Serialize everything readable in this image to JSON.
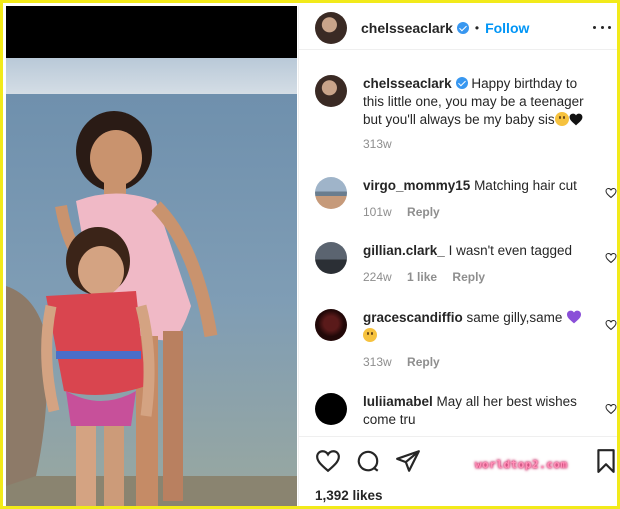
{
  "post": {
    "username": "chelsseaclark",
    "follow_label": "Follow",
    "dot": "•"
  },
  "comments": [
    {
      "username": "chelsseaclark",
      "text": "Happy birthday to this little one, you may be a teenager but you'll always be my baby sis",
      "time": "313w",
      "likes": "",
      "reply": ""
    },
    {
      "username": "virgo_mommy15",
      "text": "Matching hair cut",
      "time": "101w",
      "likes": "",
      "reply": "Reply"
    },
    {
      "username": "gillian.clark_",
      "text": "I wasn't even tagged",
      "time": "224w",
      "likes": "1 like",
      "reply": "Reply"
    },
    {
      "username": "gracescandiffio",
      "text": "same gilly,same",
      "time": "313w",
      "likes": "",
      "reply": "Reply"
    },
    {
      "username": "luliiamabel",
      "text": "May all her best wishes come tru",
      "time": "",
      "likes": "",
      "reply": ""
    }
  ],
  "likes_count": "1,392 likes",
  "watermark": "worldtop2.com",
  "icons": {
    "more": "more-options-icon",
    "like": "heart-icon",
    "comment": "comment-icon",
    "share": "paper-plane-icon",
    "save": "bookmark-icon"
  },
  "colors": {
    "frame_border": "#f2ea1a",
    "follow_blue": "#0095f6",
    "verified_blue": "#3897f0",
    "meta_gray": "#8e8e8e",
    "text": "#262626"
  }
}
